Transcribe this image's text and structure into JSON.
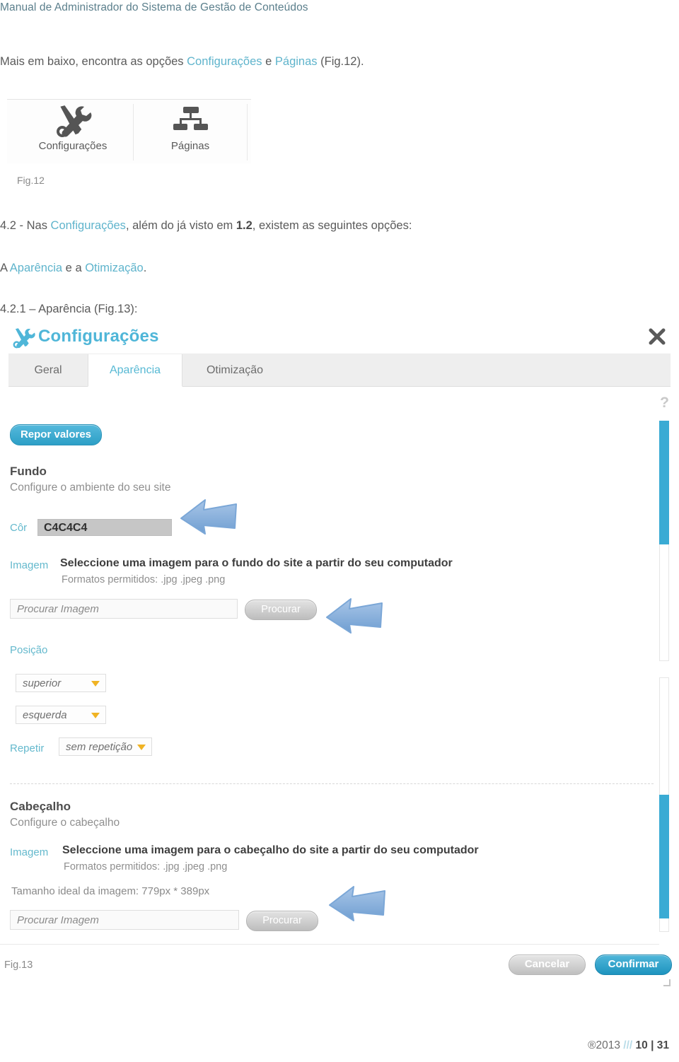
{
  "document": {
    "running_header": "Manual de Administrador do Sistema de Gestão de Conteúdos",
    "footer": {
      "copyright": "®2013",
      "separator": "///",
      "page": "10",
      "total": "31",
      "divider": "|"
    }
  },
  "intro": {
    "line_a": "Mais em baixo, encontra as opções ",
    "link_config": "Configurações",
    "line_b": " e ",
    "link_pages": "Páginas",
    "line_c": " (Fig.12)."
  },
  "fig12": {
    "label": "Fig.12",
    "items": [
      {
        "icon": "tools-icon",
        "caption": "Configurações"
      },
      {
        "icon": "sitemap-icon",
        "caption": "Páginas"
      }
    ]
  },
  "section_42": {
    "prefix": "4.2 - Nas ",
    "link_config": "Configurações",
    "mid": ", além do já visto em ",
    "bold_ref": "1.2",
    "suffix": ", existem as seguintes opções:",
    "line2_prefix": "A ",
    "line2_link1": "Aparência",
    "line2_mid": " e a ",
    "line2_link2": "Otimização",
    "line2_suffix": ".",
    "line3": "4.2.1 – Aparência (Fig.13):"
  },
  "dialog": {
    "title": "Configurações",
    "title_icon": "tools-icon",
    "close_icon": "close-icon",
    "help_icon": "help-question-icon",
    "tabs": [
      {
        "label": "Geral",
        "active": false
      },
      {
        "label": "Aparência",
        "active": true
      },
      {
        "label": "Otimização",
        "active": false
      }
    ],
    "reset_button": "Repor valores",
    "fundo": {
      "title": "Fundo",
      "subtitle": "Configure o ambiente do seu site",
      "color_label": "Côr",
      "color_value": "C4C4C4",
      "image_label": "Imagem",
      "image_headline": "Seleccione uma imagem para o fundo do site a partir do seu computador",
      "formats": "Formatos permitidos: .jpg .jpeg .png",
      "file_placeholder": "Procurar Imagem",
      "browse_button": "Procurar",
      "position_label": "Posição",
      "position_vertical": "superior",
      "position_horizontal": "esquerda",
      "repeat_label": "Repetir",
      "repeat_value": "sem repetição"
    },
    "cabecalho": {
      "title": "Cabeçalho",
      "subtitle": "Configure o cabeçalho",
      "image_label": "Imagem",
      "image_headline": "Seleccione uma imagem para o cabeçalho do site a partir do seu computador",
      "formats": "Formatos permitidos: .jpg .jpeg .png",
      "ideal_size": "Tamanho ideal da imagem: 779px * 389px",
      "file_placeholder": "Procurar Imagem",
      "browse_button": "Procurar"
    },
    "footer": {
      "cancel_button": "Cancelar",
      "confirm_button": "Confirmar"
    }
  },
  "fig13": {
    "label": "Fig.13"
  },
  "colors": {
    "accent_blue": "#4fb6d8",
    "link_blue": "#5fb4cc",
    "scrollbar_blue": "#3aabd4",
    "caret_orange": "#f0b323",
    "header_teal": "#5b7f8c",
    "color_field_bg": "#c6c6c6",
    "arrow_blue": "#7ba7d7"
  }
}
